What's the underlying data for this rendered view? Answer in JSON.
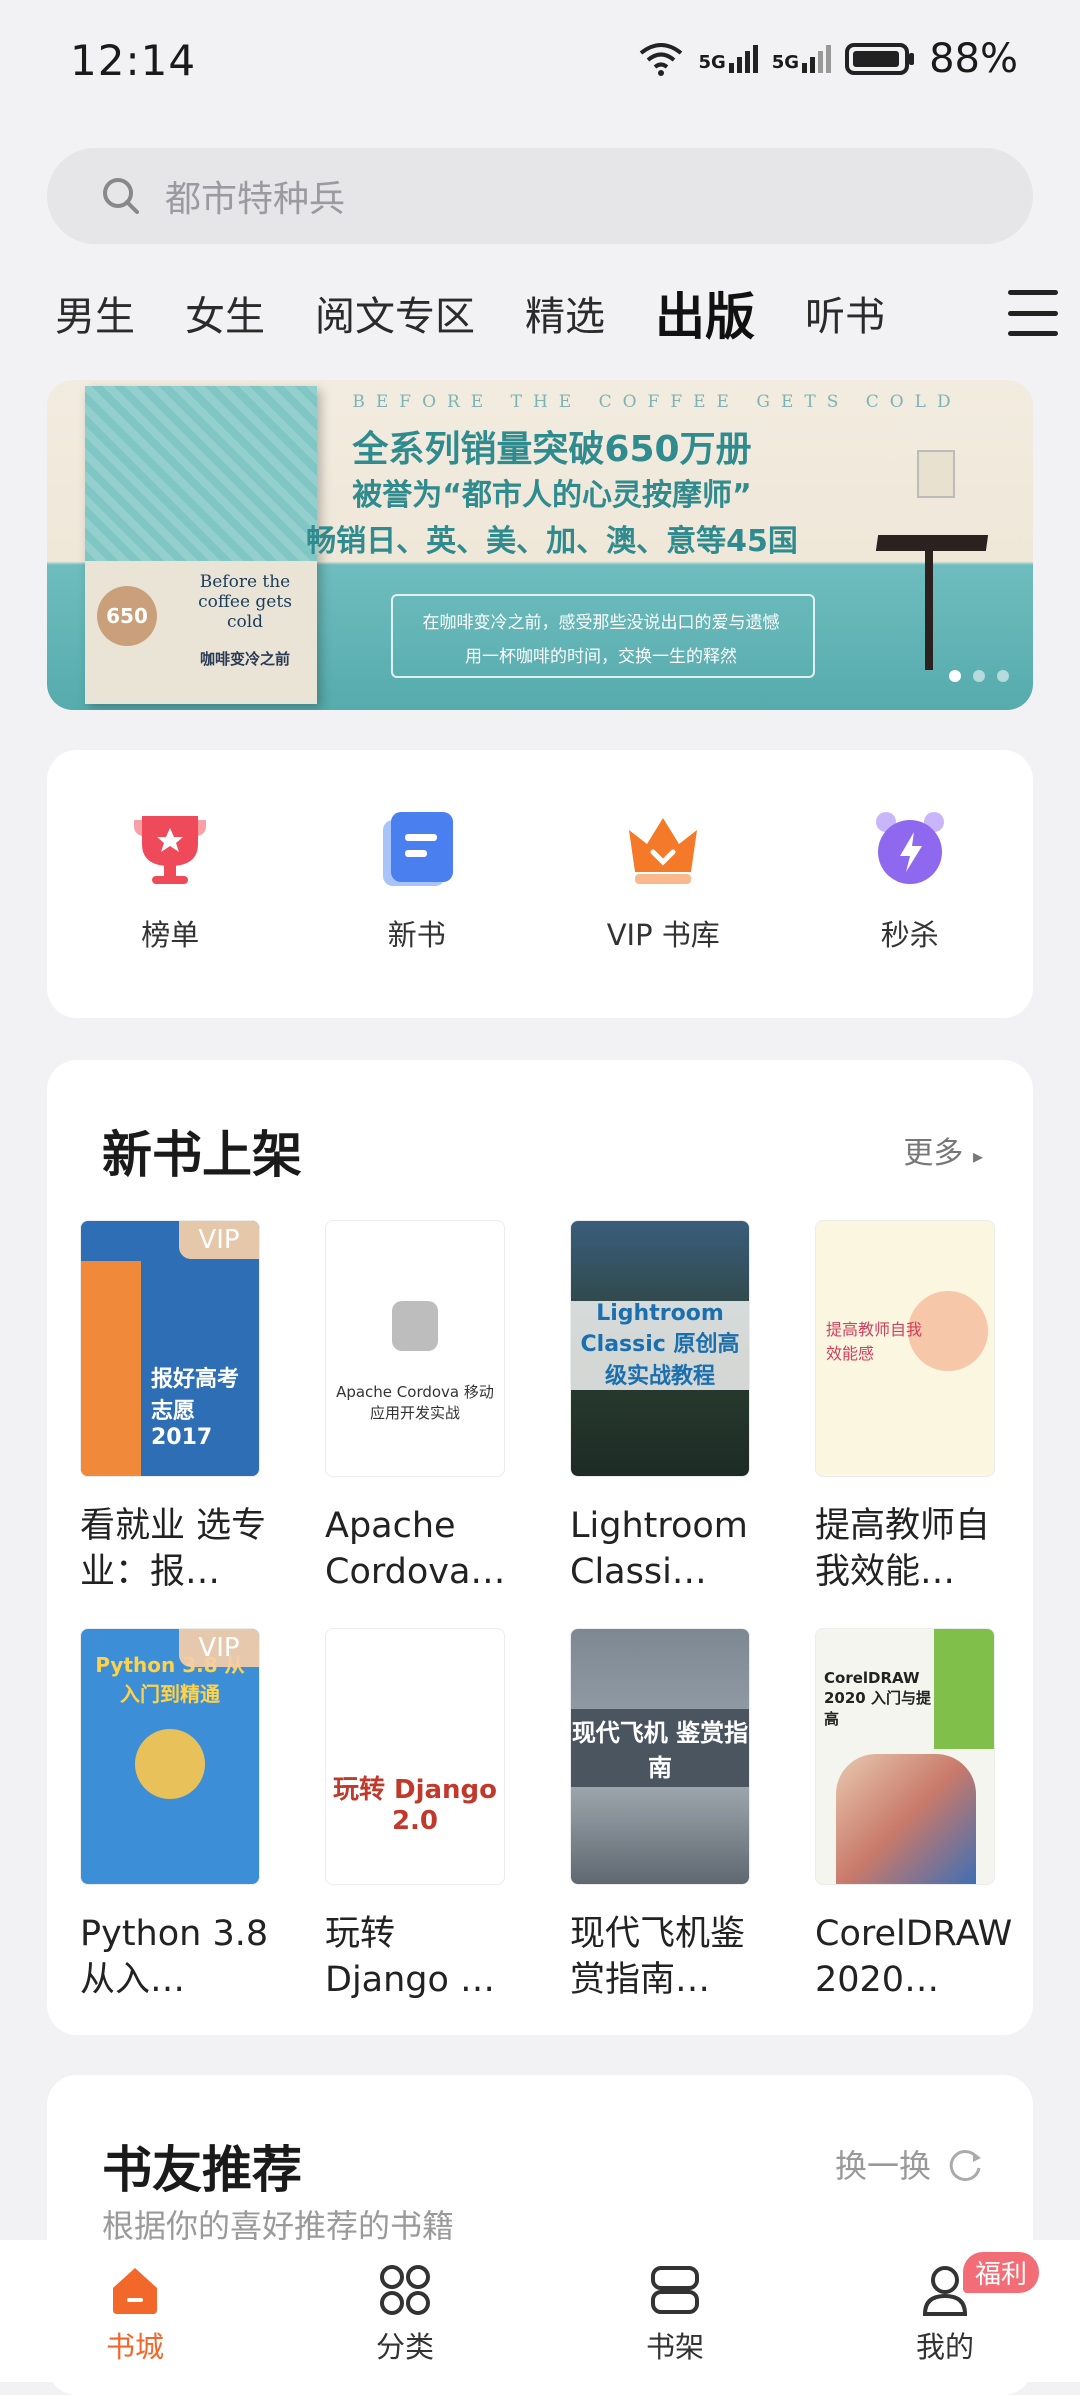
{
  "status_bar": {
    "time": "12:14",
    "network1": "5G",
    "network2": "5G",
    "battery": "88%"
  },
  "search": {
    "placeholder": "都市特种兵"
  },
  "tabs": [
    {
      "label": "男生"
    },
    {
      "label": "女生"
    },
    {
      "label": "阅文专区"
    },
    {
      "label": "精选"
    },
    {
      "label": "出版",
      "active": true
    },
    {
      "label": "听书"
    }
  ],
  "banner": {
    "english": "BEFORE THE COFFEE GETS COLD",
    "line1": "全系列销量突破650万册",
    "line2": "被誉为“都市人的心灵按摩师”",
    "line3": "畅销日、英、美、加、澳、意等45国",
    "sub1": "在咖啡变冷之前，感受那些没说出口的爱与遗憾",
    "sub2": "用一杯咖啡的时间，交换一生的释然",
    "book_title_en": "Before the coffee gets cold",
    "book_title_cn": "咖啡变冷之前",
    "sales_seal": "650",
    "dots": 3,
    "active_dot": 0
  },
  "quick_entries": [
    {
      "label": "榜单",
      "icon": "trophy-icon",
      "color": "#ef4a5a"
    },
    {
      "label": "新书",
      "icon": "new-book-icon",
      "color": "#4a7ff0"
    },
    {
      "label": "VIP 书库",
      "icon": "crown-icon",
      "color": "#f47a2a"
    },
    {
      "label": "秒杀",
      "icon": "alarm-lightning-icon",
      "color": "#8f68f0"
    }
  ],
  "new_books": {
    "title": "新书上架",
    "more": "更多",
    "books": [
      {
        "title": "看就业 选专业：报…",
        "vip": "VIP",
        "cover_text": "报好高考志愿 2017",
        "cover_bg": "#2d6eb4"
      },
      {
        "title": "Apache Cordova…",
        "vip": "",
        "cover_text": "Apache Cordova 移动应用开发实战",
        "cover_bg": "#ffffff"
      },
      {
        "title": "Lightroom Classi…",
        "vip": "",
        "cover_text": "Lightroom Classic 原创高级实战教程",
        "cover_bg": "#1d2b25"
      },
      {
        "title": "提高教师自我效能…",
        "vip": "",
        "cover_text": "提高教师自我效能感",
        "cover_bg": "#faf6df"
      },
      {
        "title": "Python 3.8从入…",
        "vip": "VIP",
        "cover_text": "Python 3.8 从入门到精通",
        "cover_bg": "#3c8fd6"
      },
      {
        "title": "玩转 Django …",
        "vip": "",
        "cover_text": "玩转 Django 2.0",
        "cover_bg": "#ffffff"
      },
      {
        "title": "现代飞机鉴赏指南…",
        "vip": "",
        "cover_text": "现代飞机 鉴赏指南",
        "cover_bg": "#8a9099"
      },
      {
        "title": "CorelDRAW 2020…",
        "vip": "",
        "cover_text": "CorelDRAW 2020 入门与提高",
        "cover_bg": "#f5f5f0"
      }
    ]
  },
  "recommend": {
    "title": "书友推荐",
    "subtitle": "根据你的喜好推荐的书籍",
    "swap": "换一换"
  },
  "bottom_nav": [
    {
      "label": "书城",
      "icon": "home-icon",
      "active": true
    },
    {
      "label": "分类",
      "icon": "category-icon"
    },
    {
      "label": "书架",
      "icon": "bookshelf-icon"
    },
    {
      "label": "我的",
      "icon": "profile-icon",
      "badge": "福利"
    }
  ],
  "colors": {
    "accent": "#f2682b",
    "background": "#f2f2f4"
  }
}
